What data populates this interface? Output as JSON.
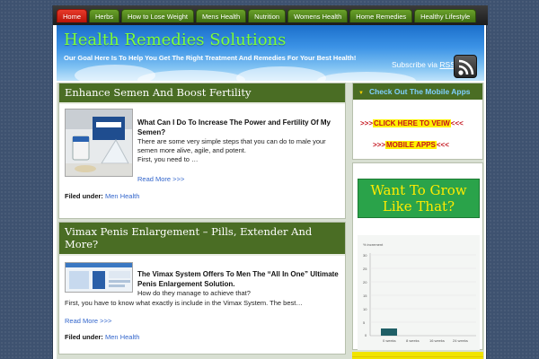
{
  "nav": {
    "items": [
      {
        "label": "Home",
        "active": true
      },
      {
        "label": "Herbs"
      },
      {
        "label": "How to Lose Weight"
      },
      {
        "label": "Mens Health"
      },
      {
        "label": "Nutrition"
      },
      {
        "label": "Womens Health"
      },
      {
        "label": "Home Remedies"
      },
      {
        "label": "Healthy Lifestyle"
      }
    ]
  },
  "header": {
    "title": "Health Remedies Solutions",
    "tagline": "Our Goal Here Is To Help You Get The Right Treatment And Remedies For Your Best Health!",
    "subscribe_prefix": "Subscribe via ",
    "subscribe_link": "RSS",
    "rss_icon": "rss-feed-icon"
  },
  "posts": [
    {
      "title": "Enhance Semen And Boost Fertility",
      "excerpt_heading": "What Can I Do To Increase The Power and Fertility Of My Semen?",
      "excerpt_lines": [
        "There are some very simple steps that you can do to male your semen more alive, agile, and potent.",
        "First, you need to …"
      ],
      "read_more": "Read More >>>",
      "filed_label": "Filed under:",
      "category": "Men Health"
    },
    {
      "title": "Vimax Penis Enlargement – Pills, Extender And More?",
      "excerpt_heading": "The Vimax System Offers To Men The “All In One” Ultimate Penis Enlargement Solution.",
      "excerpt_lines": [
        "How do they manage to achieve that?",
        "First, you have to know what exactly is include in the Vimax System. The best…"
      ],
      "read_more": "Read More >>>",
      "filed_label": "Filed under:",
      "category": "Men Health"
    }
  ],
  "sidebar": {
    "mobile_heading": "Check Out The Mobile Apps",
    "mobile_link_1": {
      "prefix": ">>>",
      "text": "CLICK HERE TO VEIW",
      "suffix": "<<<"
    },
    "mobile_link_2": {
      "prefix": ">>>",
      "text": "MOBILE APPS",
      "suffix": "<<<"
    },
    "grow_ad_text": "Want To Grow Like That?",
    "chart_ad": {
      "ylabel": "% increment",
      "y_ticks": [
        "30",
        "25",
        "20",
        "15",
        "10",
        "5",
        "0"
      ],
      "x_ticks": [
        "0 weeks",
        "8 weeks",
        "16 weeks",
        "24 weeks"
      ]
    }
  },
  "colors": {
    "nav_tab": "#4f8a1c",
    "nav_active": "#d62b1d",
    "title_green": "#7dff3a",
    "post_header": "#4a6d24",
    "link": "#3366cc",
    "ad_green": "#2aa34a",
    "ad_yellow": "#ffeb00"
  }
}
